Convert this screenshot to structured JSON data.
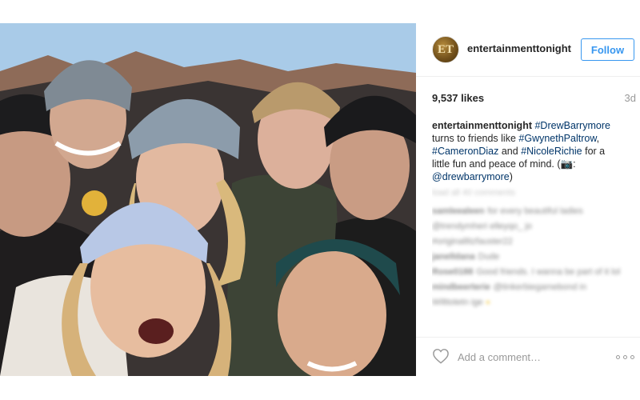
{
  "post": {
    "username": "entertainmenttonight",
    "avatar_text": "ET",
    "follow_label": "Follow",
    "likes": "9,537 likes",
    "age": "3d",
    "caption": {
      "author": "entertainmenttonight",
      "tag1": "#DrewBarrymore",
      "text1": " turns to friends like ",
      "tag2": "#GwynethPaltrow",
      "text2": ", ",
      "tag3": "#CameronDiaz",
      "text3": " and ",
      "tag4": "#NicoleRichie",
      "text4": " for a little fun and peace of mind. (",
      "camera": "📷",
      "text5": ": ",
      "tag5": "@drewbarrymore",
      "text6": ")"
    },
    "comments": [
      {
        "user": "",
        "text": "load all 40 comments"
      },
      {
        "user": "samleealeen",
        "text": "for every beautiful ladies"
      },
      {
        "user": "",
        "text": "@trendymheri elleyqo_ jo"
      },
      {
        "user": "",
        "text": "#originallitzfauster22"
      },
      {
        "user": "janelldana",
        "text": "Dude"
      },
      {
        "user": "Rose0188",
        "text": "Good friends. I wanna be part of it lol"
      },
      {
        "user": "mindbeerterie",
        "text": "@tinkerbiegamebond in"
      },
      {
        "user": "",
        "text": "Wilttotetn ige"
      }
    ],
    "comment_placeholder": "Add a comment…"
  },
  "colors": {
    "accent": "#3897f0",
    "tag": "#003569",
    "muted": "#999999",
    "divider": "#efefef"
  },
  "icons": {
    "like": "heart-icon",
    "more": "more-options-icon"
  }
}
